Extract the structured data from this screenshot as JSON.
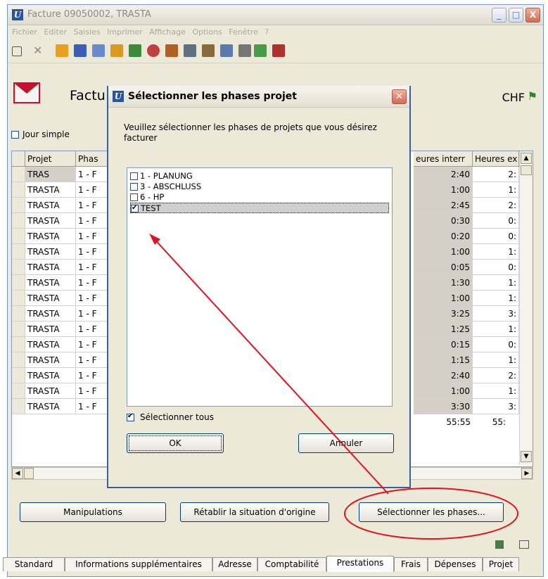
{
  "window": {
    "title": "Facture 09050002, TRASTA",
    "minimize": "_",
    "maximize": "□",
    "close": "X"
  },
  "menu": [
    "Fichier",
    "Editer",
    "Saisies",
    "Imprimer",
    "Affichage",
    "Options",
    "Fenêtre",
    "?"
  ],
  "header": {
    "title": "Factu",
    "currency": "CHF",
    "flag_glyph": "⚑"
  },
  "jour_simple": {
    "label": "Jour simple",
    "checked": false
  },
  "grid": {
    "columns": [
      "Projet",
      "Phas",
      "eures interr",
      "Heures ex"
    ],
    "rows": [
      {
        "projet": "TRAS",
        "phase": "1 - F",
        "interne": "2:40",
        "externe": "2:"
      },
      {
        "projet": "TRASTA",
        "phase": "1 - F",
        "interne": "1:00",
        "externe": "1:"
      },
      {
        "projet": "TRASTA",
        "phase": "1 - F",
        "interne": "2:45",
        "externe": "2:"
      },
      {
        "projet": "TRASTA",
        "phase": "1 - F",
        "interne": "0:30",
        "externe": "0:"
      },
      {
        "projet": "TRASTA",
        "phase": "1 - F",
        "interne": "0:20",
        "externe": "0:"
      },
      {
        "projet": "TRASTA",
        "phase": "1 - F",
        "interne": "1:00",
        "externe": "1:"
      },
      {
        "projet": "TRASTA",
        "phase": "1 - F",
        "interne": "0:05",
        "externe": "0:"
      },
      {
        "projet": "TRASTA",
        "phase": "1 - F",
        "interne": "1:30",
        "externe": "1:"
      },
      {
        "projet": "TRASTA",
        "phase": "1 - F",
        "interne": "1:00",
        "externe": "1:"
      },
      {
        "projet": "TRASTA",
        "phase": "1 - F",
        "interne": "3:25",
        "externe": "3:"
      },
      {
        "projet": "TRASTA",
        "phase": "1 - F",
        "interne": "1:25",
        "externe": "1:"
      },
      {
        "projet": "TRASTA",
        "phase": "1 - F",
        "interne": "0:15",
        "externe": "0:"
      },
      {
        "projet": "TRASTA",
        "phase": "1 - F",
        "interne": "1:15",
        "externe": "1:"
      },
      {
        "projet": "TRASTA",
        "phase": "1 - F",
        "interne": "2:40",
        "externe": "2:"
      },
      {
        "projet": "TRASTA",
        "phase": "1 - F",
        "interne": "1:00",
        "externe": "1:"
      },
      {
        "projet": "TRASTA",
        "phase": "1 - F",
        "interne": "3:30",
        "externe": "3:"
      }
    ],
    "totals": {
      "interne": "55:55",
      "externe": "55:"
    }
  },
  "buttons": {
    "manipulations": "Manipulations",
    "retablir": "Rétablir la situation d'origine",
    "selectionner_phases": "Sélectionner les phases..."
  },
  "tabs": [
    "Standard",
    "Informations supplémentaires",
    "Adresse",
    "Comptabilité",
    "Prestations",
    "Frais",
    "Dépenses",
    "Projet"
  ],
  "active_tab": "Prestations",
  "dialog": {
    "title": "Sélectionner les phases projet",
    "message": "Veuillez sélectionner les phases de projets que vous désirez facturer",
    "phases": [
      {
        "label": "1 - PLANUNG",
        "checked": false
      },
      {
        "label": "3 - ABSCHLUSS",
        "checked": false
      },
      {
        "label": "6 - HP",
        "checked": false
      },
      {
        "label": "TEST",
        "checked": true
      }
    ],
    "select_all": {
      "label": "Sélectionner tous",
      "checked": true
    },
    "ok_label": "OK",
    "cancel_label": "Annuler"
  },
  "colors": {
    "annotation": "#e0141e",
    "title_blue": "#29549e"
  }
}
